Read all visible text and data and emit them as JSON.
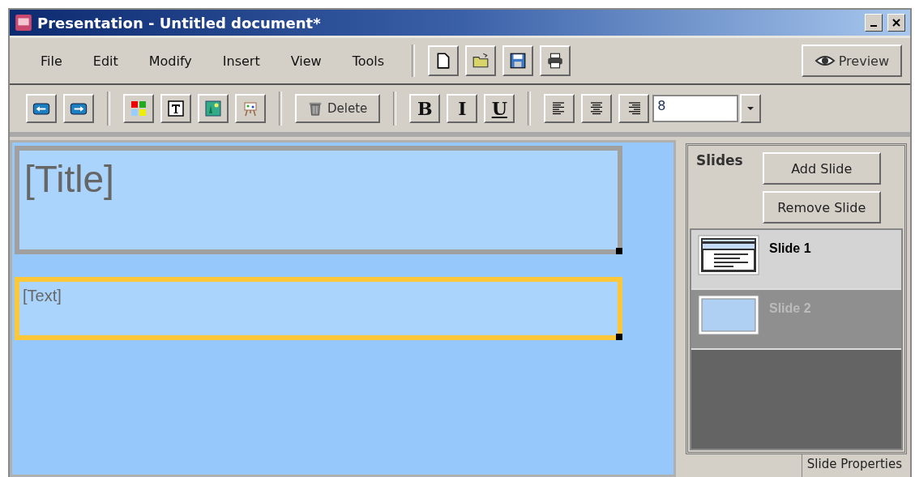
{
  "window": {
    "title": "Presentation - Untitled document*"
  },
  "menu": [
    "File",
    "Edit",
    "Modify",
    "Insert",
    "View",
    "Tools"
  ],
  "file_tools": [
    {
      "kind": "new"
    },
    {
      "kind": "open"
    },
    {
      "kind": "save"
    },
    {
      "kind": "print"
    }
  ],
  "preview_button": "Preview",
  "toolbar": {
    "delete_button": "Delete",
    "bold": "B",
    "italic": "I",
    "underline": "U",
    "font_size": "8"
  },
  "canvas": {
    "boxes": [
      {
        "kind": "title",
        "text": "[Title]",
        "selected": false
      },
      {
        "kind": "text",
        "text": "[Text]",
        "selected": true
      }
    ]
  },
  "slides_panel": {
    "heading": "Slides",
    "add_button": "Add Slide",
    "remove_button": "Remove Slide",
    "slides": [
      {
        "label": "Slide 1",
        "kind": "title-text",
        "selected": true
      },
      {
        "label": "Slide 2",
        "kind": "blank",
        "selected": false
      }
    ],
    "tab": "Slide Properties"
  }
}
